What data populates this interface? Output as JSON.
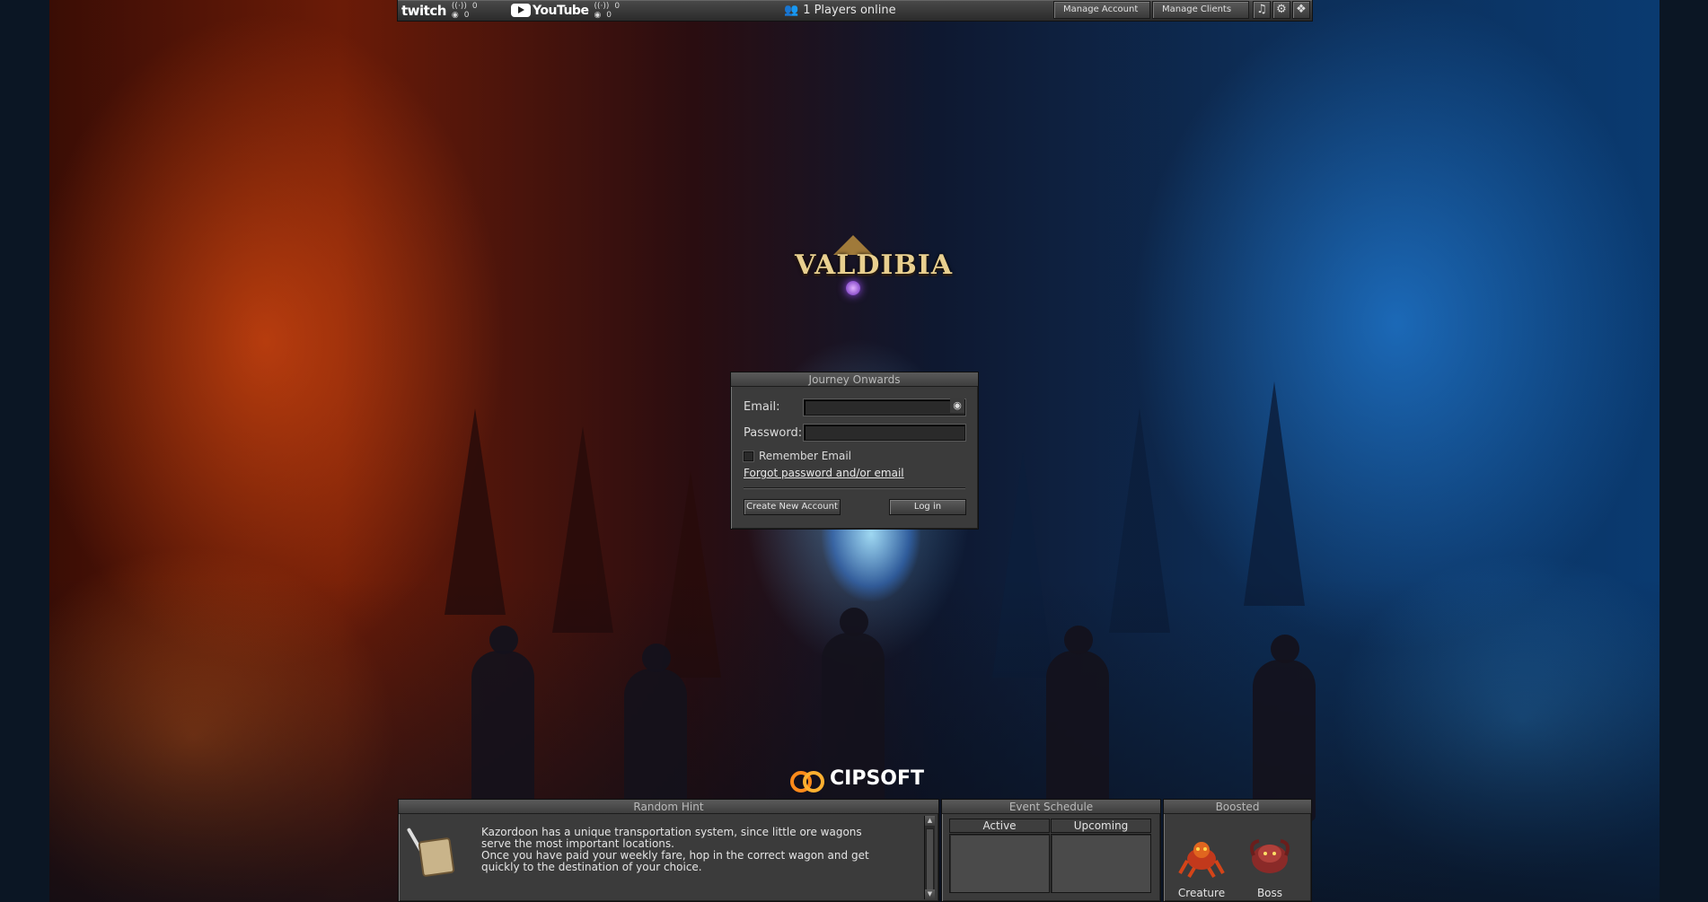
{
  "topbar": {
    "twitch": {
      "logo": "twitch",
      "viewers": "0",
      "watchers": "0"
    },
    "youtube": {
      "logo": "YouTube",
      "viewers": "0",
      "watchers": "0"
    },
    "players_online": "1 Players online",
    "manage_account": "Manage Account",
    "manage_clients": "Manage Clients",
    "icons": [
      "music-icon",
      "gear-icon",
      "widgets-icon"
    ]
  },
  "logo": {
    "text": "VALDIBIA"
  },
  "login": {
    "title": "Journey Onwards",
    "email_label": "Email:",
    "email_value": "",
    "password_label": "Password:",
    "password_value": "",
    "remember_label": "Remember Email",
    "remember_checked": false,
    "forgot_link": "Forgot password and/or email",
    "create_button": "Create New Account",
    "login_button": "Log in"
  },
  "brand": {
    "cipsoft": "CIPSOFT"
  },
  "hint": {
    "title": "Random Hint",
    "lines": [
      "Kazordoon has a unique transportation system, since little ore wagons",
      "serve the most important locations.",
      "Once you have paid your weekly fare, hop in the correct wagon and get",
      "quickly to the destination of your choice."
    ]
  },
  "events": {
    "title": "Event Schedule",
    "active": "Active",
    "upcoming": "Upcoming"
  },
  "boosted": {
    "title": "Boosted",
    "creature_label": "Creature",
    "boss_label": "Boss"
  },
  "colors": {
    "panel": "#3b3b3b",
    "accent_orange": "#ff8a1a",
    "logo_gold": "#e8cf8f"
  }
}
